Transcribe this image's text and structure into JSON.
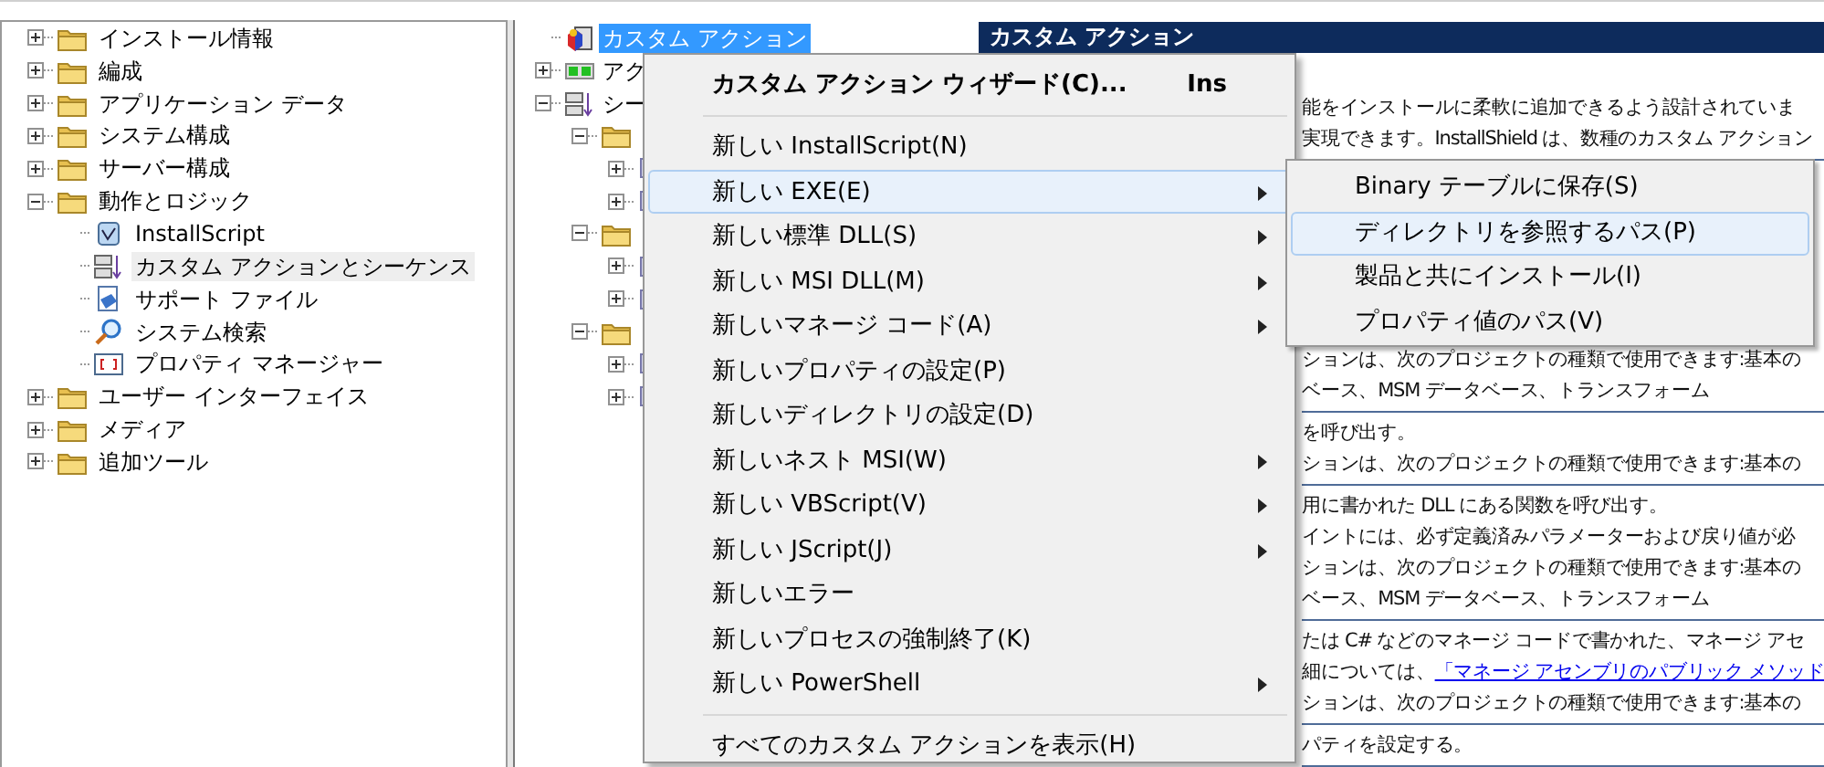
{
  "left_tree": {
    "items": [
      {
        "label": "インストール情報",
        "kind": "folder",
        "expanded": false,
        "selected": false
      },
      {
        "label": "編成",
        "kind": "folder",
        "expanded": false,
        "selected": false
      },
      {
        "label": "アプリケーション データ",
        "kind": "folder",
        "expanded": false,
        "selected": false
      },
      {
        "label": "システム構成",
        "kind": "folder",
        "expanded": false,
        "selected": false
      },
      {
        "label": "サーバー構成",
        "kind": "folder",
        "expanded": false,
        "selected": false
      },
      {
        "label": "動作とロジック",
        "kind": "folder",
        "expanded": true,
        "selected": false,
        "children": [
          {
            "label": "InstallScript",
            "kind": "script",
            "selected": false
          },
          {
            "label": "カスタム アクションとシーケンス",
            "kind": "sequence",
            "selected": true
          },
          {
            "label": "サポート ファイル",
            "kind": "support",
            "selected": false
          },
          {
            "label": "システム検索",
            "kind": "search",
            "selected": false
          },
          {
            "label": "プロパティ マネージャー",
            "kind": "property",
            "selected": false
          }
        ]
      },
      {
        "label": "ユーザー インターフェイス",
        "kind": "folder",
        "expanded": false,
        "selected": false
      },
      {
        "label": "メディア",
        "kind": "folder",
        "expanded": false,
        "selected": false
      },
      {
        "label": "追加ツール",
        "kind": "folder",
        "expanded": false,
        "selected": false
      }
    ]
  },
  "middle_tree": {
    "items": [
      {
        "label": "カスタム アクション",
        "kind": "action",
        "selected": true,
        "children": [
          {
            "label": "アク",
            "kind": "actionlist",
            "expanded": false,
            "selected": false
          },
          {
            "label": "シー",
            "kind": "sequence",
            "expanded": true,
            "selected": false,
            "children": [
              {
                "kind": "folder",
                "expanded": true,
                "children": [
                  {
                    "kind": "item",
                    "expanded": false
                  },
                  {
                    "kind": "item",
                    "expanded": false
                  }
                ]
              },
              {
                "kind": "folder",
                "expanded": true,
                "children": [
                  {
                    "kind": "item",
                    "expanded": false
                  },
                  {
                    "kind": "item",
                    "expanded": false
                  }
                ]
              },
              {
                "kind": "folder",
                "expanded": true,
                "children": [
                  {
                    "kind": "item",
                    "expanded": false
                  },
                  {
                    "kind": "item",
                    "expanded": false
                  }
                ]
              }
            ]
          }
        ]
      }
    ]
  },
  "detail": {
    "title": "カスタム アクション",
    "sections": [
      {
        "lines": [
          {
            "text": "能をインストールに柔軟に追加できるよう設計されていま"
          },
          {
            "text": "実現できます。InstallShield は、数種のカスタム アクション"
          }
        ]
      },
      {
        "lines": [
          {
            "text": "ションは、次のプロジェクトの種類で使用できます:基本の"
          },
          {
            "text": "ベース、MSM データベース、トランスフォーム"
          }
        ]
      },
      {
        "lines": [
          {
            "text": "を呼び出す。"
          },
          {
            "text": "ションは、次のプロジェクトの種類で使用できます:基本の"
          }
        ]
      },
      {
        "lines": [
          {
            "text": "用に書かれた DLL にある関数を呼び出す。"
          },
          {
            "text": "イントには、必ず定義済みパラメーターおよび戻り値が必"
          },
          {
            "text": "ションは、次のプロジェクトの種類で使用できます:基本の"
          },
          {
            "text": "ベース、MSM データベース、トランスフォーム"
          }
        ]
      },
      {
        "lines": [
          {
            "text": "たは C# などのマネージ コードで書かれた、マネージ アセ"
          },
          {
            "text": "細については、",
            "link": "「マネージ アセンブリのパブリック メソッド"
          },
          {
            "text": "ションは、次のプロジェクトの種類で使用できます:基本の"
          }
        ]
      },
      {
        "lines": [
          {
            "text": "パティを設定する。"
          }
        ]
      }
    ]
  },
  "context_menu": {
    "items": [
      {
        "kind": "item",
        "label": "カスタム アクション ウィザード(C)...",
        "shortcut": "Ins",
        "default": true,
        "selected": false,
        "submenu": false
      },
      {
        "kind": "separator"
      },
      {
        "kind": "item",
        "label": "新しい InstallScript(N)",
        "default": false,
        "selected": false,
        "submenu": false
      },
      {
        "kind": "item",
        "label": "新しい EXE(E)",
        "default": false,
        "selected": true,
        "submenu": true
      },
      {
        "kind": "item",
        "label": "新しい標準 DLL(S)",
        "default": false,
        "selected": false,
        "submenu": true
      },
      {
        "kind": "item",
        "label": "新しい MSI DLL(M)",
        "default": false,
        "selected": false,
        "submenu": true
      },
      {
        "kind": "item",
        "label": "新しいマネージ コード(A)",
        "default": false,
        "selected": false,
        "submenu": true
      },
      {
        "kind": "item",
        "label": "新しいプロパティの設定(P)",
        "default": false,
        "selected": false,
        "submenu": false
      },
      {
        "kind": "item",
        "label": "新しいディレクトリの設定(D)",
        "default": false,
        "selected": false,
        "submenu": false
      },
      {
        "kind": "item",
        "label": "新しいネスト MSI(W)",
        "default": false,
        "selected": false,
        "submenu": true
      },
      {
        "kind": "item",
        "label": "新しい VBScript(V)",
        "default": false,
        "selected": false,
        "submenu": true
      },
      {
        "kind": "item",
        "label": "新しい JScript(J)",
        "default": false,
        "selected": false,
        "submenu": true
      },
      {
        "kind": "item",
        "label": "新しいエラー",
        "default": false,
        "selected": false,
        "submenu": false
      },
      {
        "kind": "item",
        "label": "新しいプロセスの強制終了(K)",
        "default": false,
        "selected": false,
        "submenu": false
      },
      {
        "kind": "item",
        "label": "新しい PowerShell",
        "default": false,
        "selected": false,
        "submenu": true
      },
      {
        "kind": "separator"
      },
      {
        "kind": "item",
        "label": "すべてのカスタム アクションを表示(H)",
        "default": false,
        "selected": false,
        "submenu": false
      }
    ]
  },
  "submenu": {
    "items": [
      {
        "label": "Binary テーブルに保存(S)",
        "selected": false
      },
      {
        "label": "ディレクトリを参照するパス(P)",
        "selected": true
      },
      {
        "label": "製品と共にインストール(I)",
        "selected": false
      },
      {
        "label": "プロパティ値のパス(V)",
        "selected": false
      }
    ]
  }
}
